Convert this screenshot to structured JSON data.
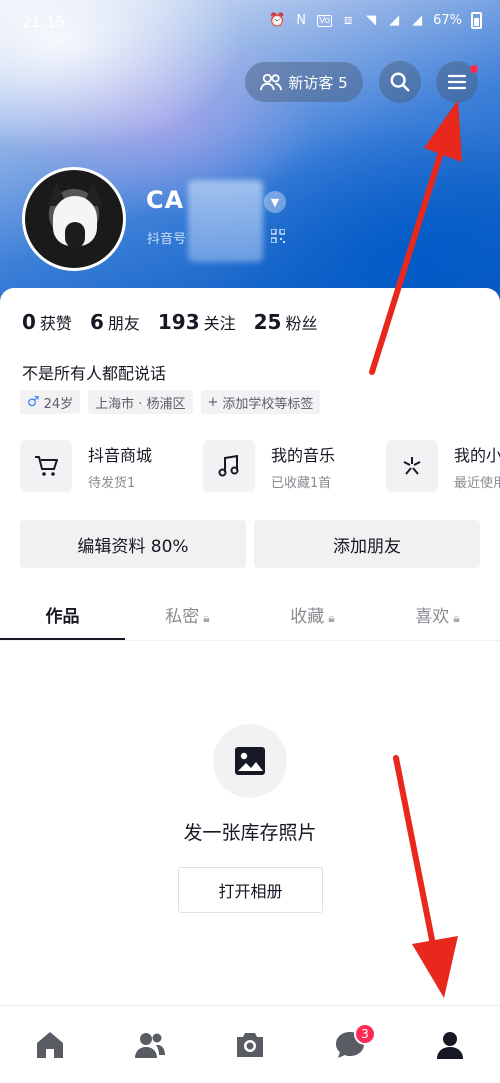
{
  "status_bar": {
    "time": "21:15",
    "icons": [
      "alarm-icon",
      "nfc-icon",
      "volte-icon",
      "vibrate-icon",
      "wifi-icon",
      "signal-4g-icon",
      "signal-4g-icon"
    ],
    "battery": "67%"
  },
  "header": {
    "visitors_label": "新访客 5",
    "username": "CA",
    "douyin_id_label": "抖音号"
  },
  "stats": [
    {
      "num": "0",
      "label": "获赞"
    },
    {
      "num": "6",
      "label": "朋友"
    },
    {
      "num": "193",
      "label": "关注"
    },
    {
      "num": "25",
      "label": "粉丝"
    }
  ],
  "bio": "不是所有人都配说话",
  "tags": {
    "age": "24岁",
    "location": "上海市 · 杨浦区",
    "add_school": "添加学校等标签"
  },
  "shortcuts": [
    {
      "title": "抖音商城",
      "sub": "待发货1",
      "icon": "cart-icon"
    },
    {
      "title": "我的音乐",
      "sub": "已收藏1首",
      "icon": "music-note-icon"
    },
    {
      "title": "我的小",
      "sub": "最近使用",
      "icon": "mini-program-icon"
    }
  ],
  "actions": {
    "edit_profile": "编辑资料 80%",
    "add_friend": "添加朋友"
  },
  "tabs": [
    {
      "label": "作品",
      "locked": false
    },
    {
      "label": "私密",
      "locked": true
    },
    {
      "label": "收藏",
      "locked": true
    },
    {
      "label": "喜欢",
      "locked": true
    }
  ],
  "empty_state": {
    "text": "发一张库存照片",
    "button": "打开相册"
  },
  "bottom_nav": {
    "messages_badge": "3"
  },
  "colors": {
    "accent": "#fe2c55",
    "annotation_arrow": "#e8271d",
    "text_primary": "#161823",
    "text_secondary": "#8a8b91"
  }
}
